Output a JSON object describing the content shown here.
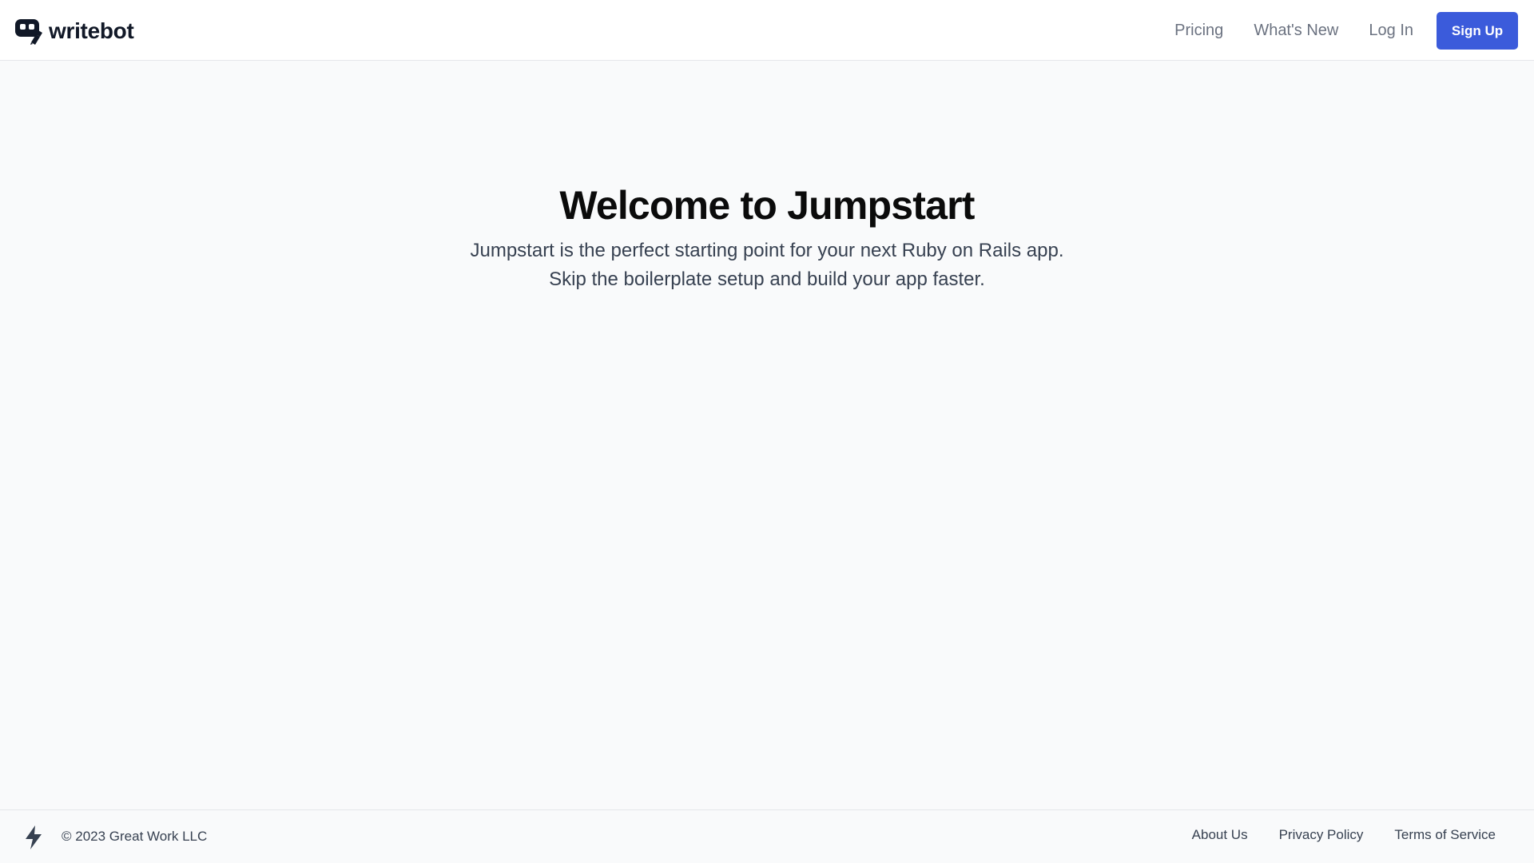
{
  "header": {
    "brand": {
      "name": "writebot",
      "icon": "writebot-logo-icon"
    },
    "nav": {
      "pricing": "Pricing",
      "whats_new": "What's New",
      "log_in": "Log In",
      "sign_up": "Sign Up"
    }
  },
  "hero": {
    "title": "Welcome to Jumpstart",
    "subtitle_line1": "Jumpstart is the perfect starting point for your next Ruby on Rails app.",
    "subtitle_line2": "Skip the boilerplate setup and build your app faster."
  },
  "footer": {
    "icon": "lightning-bolt-icon",
    "copyright": "© 2023 Great Work LLC",
    "links": {
      "about": "About Us",
      "privacy": "Privacy Policy",
      "terms": "Terms of Service"
    }
  },
  "colors": {
    "accent": "#3b5bdb",
    "background": "#f9fafb",
    "header_background": "#ffffff",
    "nav_text": "#6b7280",
    "body_text": "#374151",
    "heading_text": "#0b0b0b",
    "border": "#e5e7eb"
  }
}
